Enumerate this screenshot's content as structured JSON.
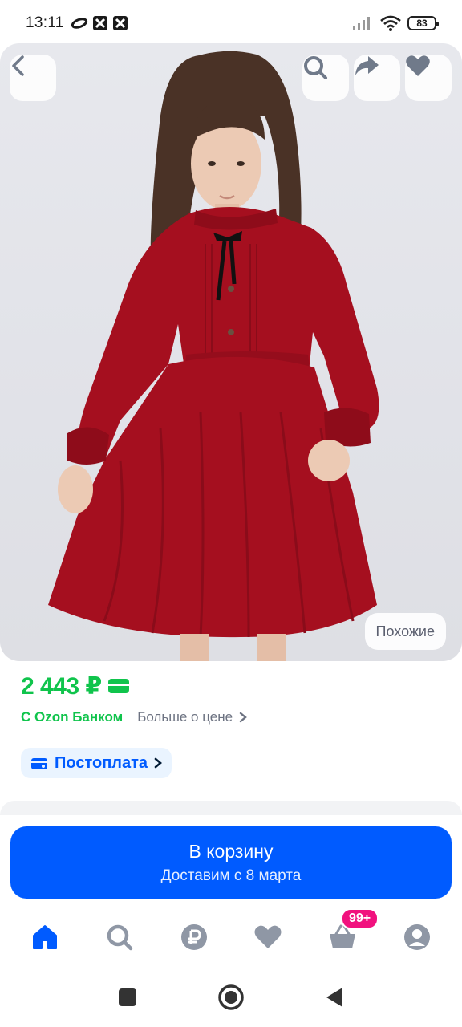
{
  "status_bar": {
    "time": "13:11",
    "battery": "83"
  },
  "product": {
    "similar_label": "Похожие"
  },
  "price": {
    "value": "2 443 ₽",
    "bank_label": "С Ozon Банком",
    "more_label": "Больше о цене"
  },
  "postpay": {
    "label": "Постоплата"
  },
  "cart": {
    "title": "В корзину",
    "subtitle": "Доставим с 8 марта"
  },
  "bottom_nav": {
    "cart_badge": "99+",
    "active_color": "#005bff",
    "inactive_color": "#8f97a5"
  },
  "colors": {
    "brand_blue": "#005bff",
    "price_green": "#10c44c",
    "badge_pink": "#f1117e"
  }
}
